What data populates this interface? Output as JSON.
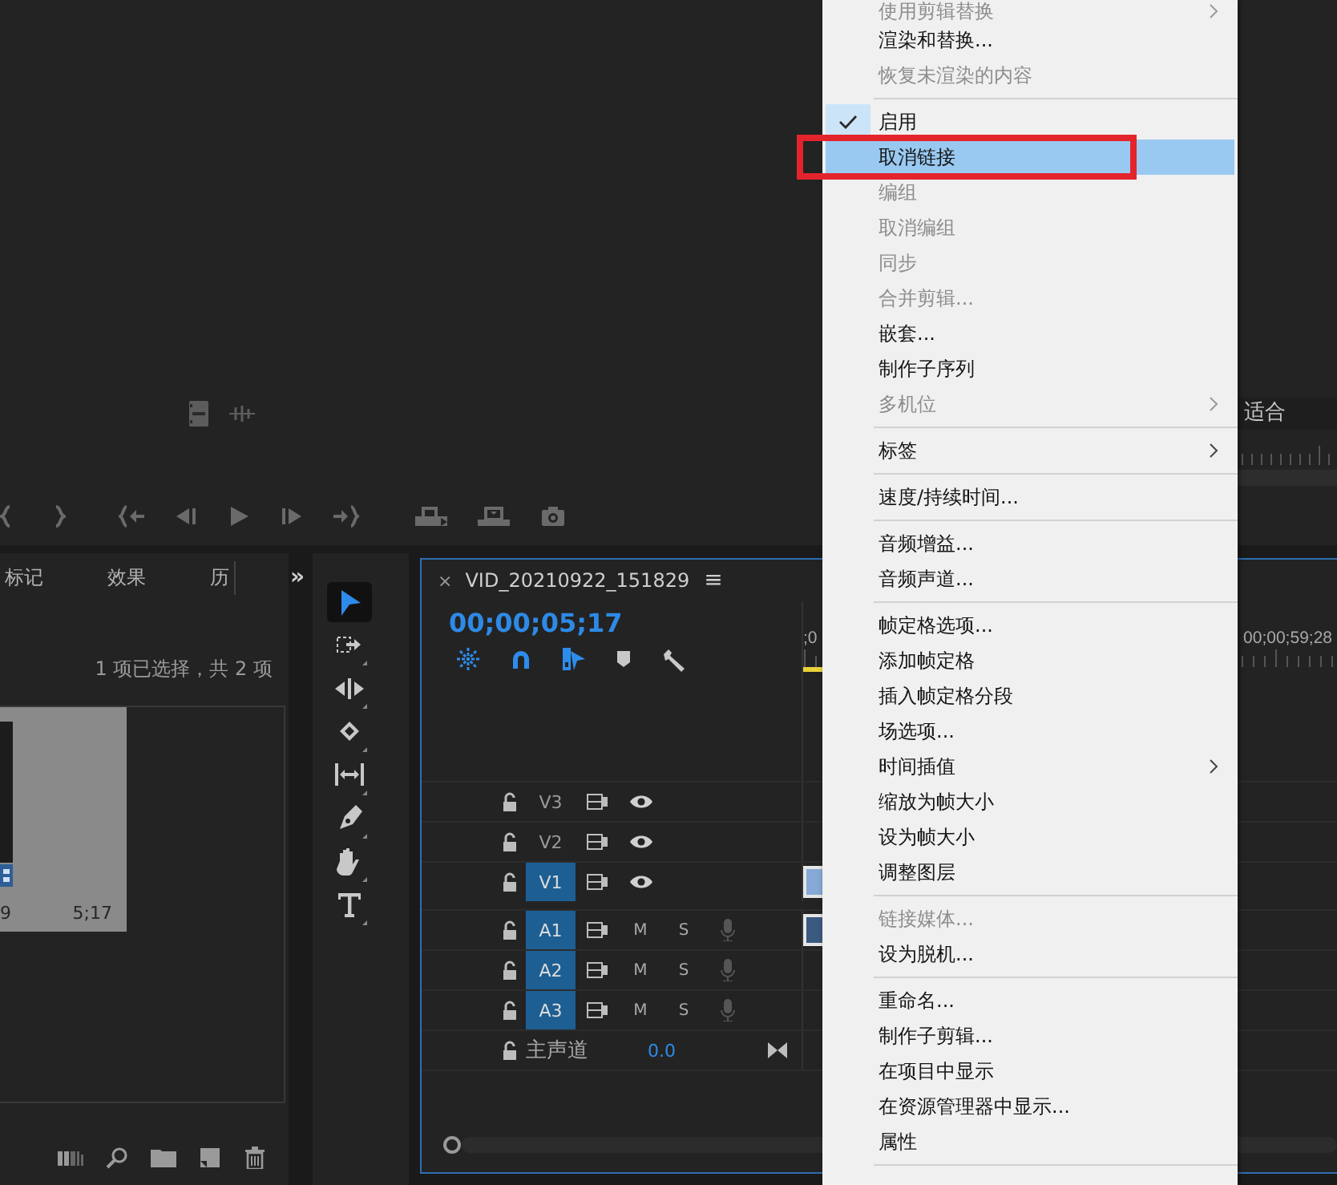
{
  "program_monitor": {
    "zoom": "适合"
  },
  "project_panel": {
    "tabs": [
      {
        "label": "标记",
        "selected": false
      },
      {
        "label": "效果",
        "selected": false
      },
      {
        "label": "历",
        "selected": false
      }
    ],
    "tabs_overflow": "»",
    "selection_status": "1 项已选择，共 2 项",
    "clip": {
      "name": "9",
      "duration": "5;17"
    }
  },
  "tools": [
    {
      "kind": "selection",
      "selected": true
    },
    {
      "kind": "track-select",
      "selected": false
    },
    {
      "kind": "ripple",
      "selected": false
    },
    {
      "kind": "razor",
      "selected": false
    },
    {
      "kind": "slip",
      "selected": false
    },
    {
      "kind": "pen",
      "selected": false
    },
    {
      "kind": "hand",
      "selected": false
    },
    {
      "kind": "type",
      "selected": false
    }
  ],
  "timeline": {
    "close": "×",
    "sequence_name": "VID_20210922_151829",
    "menu": "≡",
    "timecode": "00;00;05;17",
    "ruler_start": ";0",
    "ruler_end": "00;00;59;28",
    "tracks": [
      {
        "kind": "video",
        "name": "V3",
        "targeted": false,
        "has_clip": false
      },
      {
        "kind": "video",
        "name": "V2",
        "targeted": false,
        "has_clip": false
      },
      {
        "kind": "video",
        "name": "V1",
        "targeted": true,
        "has_clip": true
      },
      {
        "kind": "audio",
        "name": "A1",
        "targeted": true,
        "has_clip": true,
        "mute": "M",
        "solo": "S"
      },
      {
        "kind": "audio",
        "name": "A2",
        "targeted": true,
        "has_clip": false,
        "mute": "M",
        "solo": "S"
      },
      {
        "kind": "audio",
        "name": "A3",
        "targeted": true,
        "has_clip": false,
        "mute": "M",
        "solo": "S"
      }
    ],
    "master": {
      "name": "主声道",
      "value": "0.0"
    }
  },
  "context_menu": {
    "items": [
      {
        "kind": "item",
        "label": "使用剪辑替换",
        "disabled": true,
        "checked": false,
        "selected": false,
        "submenu": true,
        "annotated": false
      },
      {
        "kind": "item",
        "label": "渲染和替换...",
        "disabled": false,
        "checked": false,
        "selected": false,
        "submenu": false,
        "annotated": false
      },
      {
        "kind": "item",
        "label": "恢复未渲染的内容",
        "disabled": true,
        "checked": false,
        "selected": false,
        "submenu": false,
        "annotated": false
      },
      {
        "kind": "separator"
      },
      {
        "kind": "item",
        "label": "启用",
        "disabled": false,
        "checked": true,
        "selected": false,
        "submenu": false,
        "annotated": false
      },
      {
        "kind": "item",
        "label": "取消链接",
        "disabled": false,
        "checked": false,
        "selected": true,
        "submenu": false,
        "annotated": true
      },
      {
        "kind": "item",
        "label": "编组",
        "disabled": true,
        "checked": false,
        "selected": false,
        "submenu": false,
        "annotated": false
      },
      {
        "kind": "item",
        "label": "取消编组",
        "disabled": true,
        "checked": false,
        "selected": false,
        "submenu": false,
        "annotated": false
      },
      {
        "kind": "item",
        "label": "同步",
        "disabled": true,
        "checked": false,
        "selected": false,
        "submenu": false,
        "annotated": false
      },
      {
        "kind": "item",
        "label": "合并剪辑...",
        "disabled": true,
        "checked": false,
        "selected": false,
        "submenu": false,
        "annotated": false
      },
      {
        "kind": "item",
        "label": "嵌套...",
        "disabled": false,
        "checked": false,
        "selected": false,
        "submenu": false,
        "annotated": false
      },
      {
        "kind": "item",
        "label": "制作子序列",
        "disabled": false,
        "checked": false,
        "selected": false,
        "submenu": false,
        "annotated": false
      },
      {
        "kind": "item",
        "label": "多机位",
        "disabled": true,
        "checked": false,
        "selected": false,
        "submenu": true,
        "annotated": false
      },
      {
        "kind": "separator"
      },
      {
        "kind": "item",
        "label": "标签",
        "disabled": false,
        "checked": false,
        "selected": false,
        "submenu": true,
        "annotated": false
      },
      {
        "kind": "separator"
      },
      {
        "kind": "item",
        "label": "速度/持续时间...",
        "disabled": false,
        "checked": false,
        "selected": false,
        "submenu": false,
        "annotated": false
      },
      {
        "kind": "separator"
      },
      {
        "kind": "item",
        "label": "音频增益...",
        "disabled": false,
        "checked": false,
        "selected": false,
        "submenu": false,
        "annotated": false
      },
      {
        "kind": "item",
        "label": "音频声道...",
        "disabled": false,
        "checked": false,
        "selected": false,
        "submenu": false,
        "annotated": false
      },
      {
        "kind": "separator"
      },
      {
        "kind": "item",
        "label": "帧定格选项...",
        "disabled": false,
        "checked": false,
        "selected": false,
        "submenu": false,
        "annotated": false
      },
      {
        "kind": "item",
        "label": "添加帧定格",
        "disabled": false,
        "checked": false,
        "selected": false,
        "submenu": false,
        "annotated": false
      },
      {
        "kind": "item",
        "label": "插入帧定格分段",
        "disabled": false,
        "checked": false,
        "selected": false,
        "submenu": false,
        "annotated": false
      },
      {
        "kind": "item",
        "label": "场选项...",
        "disabled": false,
        "checked": false,
        "selected": false,
        "submenu": false,
        "annotated": false
      },
      {
        "kind": "item",
        "label": "时间插值",
        "disabled": false,
        "checked": false,
        "selected": false,
        "submenu": true,
        "annotated": false
      },
      {
        "kind": "item",
        "label": "缩放为帧大小",
        "disabled": false,
        "checked": false,
        "selected": false,
        "submenu": false,
        "annotated": false
      },
      {
        "kind": "item",
        "label": "设为帧大小",
        "disabled": false,
        "checked": false,
        "selected": false,
        "submenu": false,
        "annotated": false
      },
      {
        "kind": "item",
        "label": "调整图层",
        "disabled": false,
        "checked": false,
        "selected": false,
        "submenu": false,
        "annotated": false
      },
      {
        "kind": "separator"
      },
      {
        "kind": "item",
        "label": "链接媒体...",
        "disabled": true,
        "checked": false,
        "selected": false,
        "submenu": false,
        "annotated": false
      },
      {
        "kind": "item",
        "label": "设为脱机...",
        "disabled": false,
        "checked": false,
        "selected": false,
        "submenu": false,
        "annotated": false
      },
      {
        "kind": "separator"
      },
      {
        "kind": "item",
        "label": "重命名...",
        "disabled": false,
        "checked": false,
        "selected": false,
        "submenu": false,
        "annotated": false
      },
      {
        "kind": "item",
        "label": "制作子剪辑...",
        "disabled": false,
        "checked": false,
        "selected": false,
        "submenu": false,
        "annotated": false
      },
      {
        "kind": "item",
        "label": "在项目中显示",
        "disabled": false,
        "checked": false,
        "selected": false,
        "submenu": false,
        "annotated": false
      },
      {
        "kind": "item",
        "label": "在资源管理器中显示...",
        "disabled": false,
        "checked": false,
        "selected": false,
        "submenu": false,
        "annotated": false
      },
      {
        "kind": "item",
        "label": "属性",
        "disabled": false,
        "checked": false,
        "selected": false,
        "submenu": false,
        "annotated": false
      },
      {
        "kind": "separator"
      }
    ]
  }
}
